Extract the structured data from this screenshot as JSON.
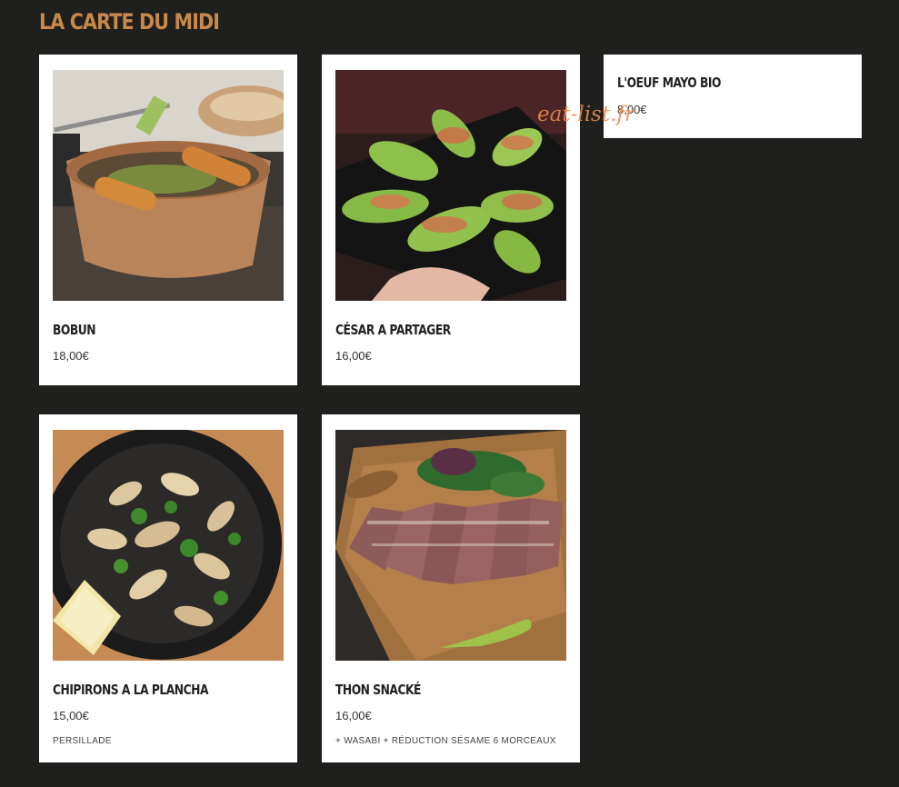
{
  "section": {
    "title": "LA CARTE DU MIDI"
  },
  "items": [
    {
      "name": "BOBUN",
      "price": "18,00€",
      "description": ""
    },
    {
      "name": "CÉSAR A PARTAGER",
      "price": "16,00€",
      "description": ""
    },
    {
      "name": "L'OEUF MAYO BIO",
      "price": "8,00€",
      "description": ""
    },
    {
      "name": "CHIPIRONS A LA PLANCHA",
      "price": "15,00€",
      "description": "PERSILLADE"
    },
    {
      "name": "THON SNACKÉ",
      "price": "16,00€",
      "description": "+ WASABI + RÉDUCTION SÉSAME 6 MORCEAUX"
    }
  ],
  "watermark": "eat-list.fr",
  "colors": {
    "background": "#1f1f1e",
    "title": "#c8894a",
    "card": "#ffffff",
    "watermark": "#f08a4b"
  }
}
